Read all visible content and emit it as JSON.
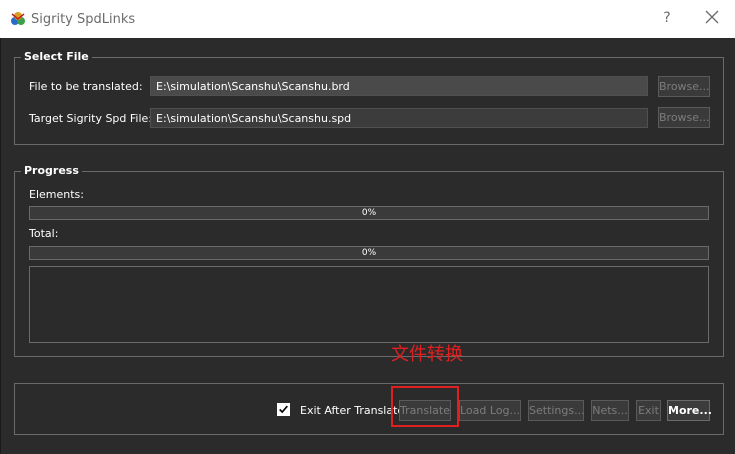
{
  "window": {
    "title": "Sigrity SpdLinks",
    "help_label": "?",
    "close_icon": "close-icon",
    "app_icon": "sigrity-app-icon"
  },
  "select_file": {
    "legend": "Select File",
    "source_label": "File to be translated:",
    "source_value": "E:\\simulation\\Scanshu\\Scanshu.brd",
    "target_label": "Target Sigrity Spd File:",
    "target_value": "E:\\simulation\\Scanshu\\Scanshu.spd",
    "browse_label": "Browse..."
  },
  "progress": {
    "legend": "Progress",
    "elements_label": "Elements:",
    "elements_value": "0%",
    "elements_fraction": 0,
    "total_label": "Total:",
    "total_value": "0%",
    "total_fraction": 0
  },
  "actions": {
    "exit_after_label": "Exit After Translate",
    "exit_after_checked": true,
    "translate_label": "Translate",
    "load_log_label": "Load Log...",
    "settings_label": "Settings...",
    "nets_label": "Nets...",
    "exit_label": "Exit",
    "more_label": "More..."
  },
  "annotation": {
    "text": "文件转换",
    "color": "#e02020"
  }
}
